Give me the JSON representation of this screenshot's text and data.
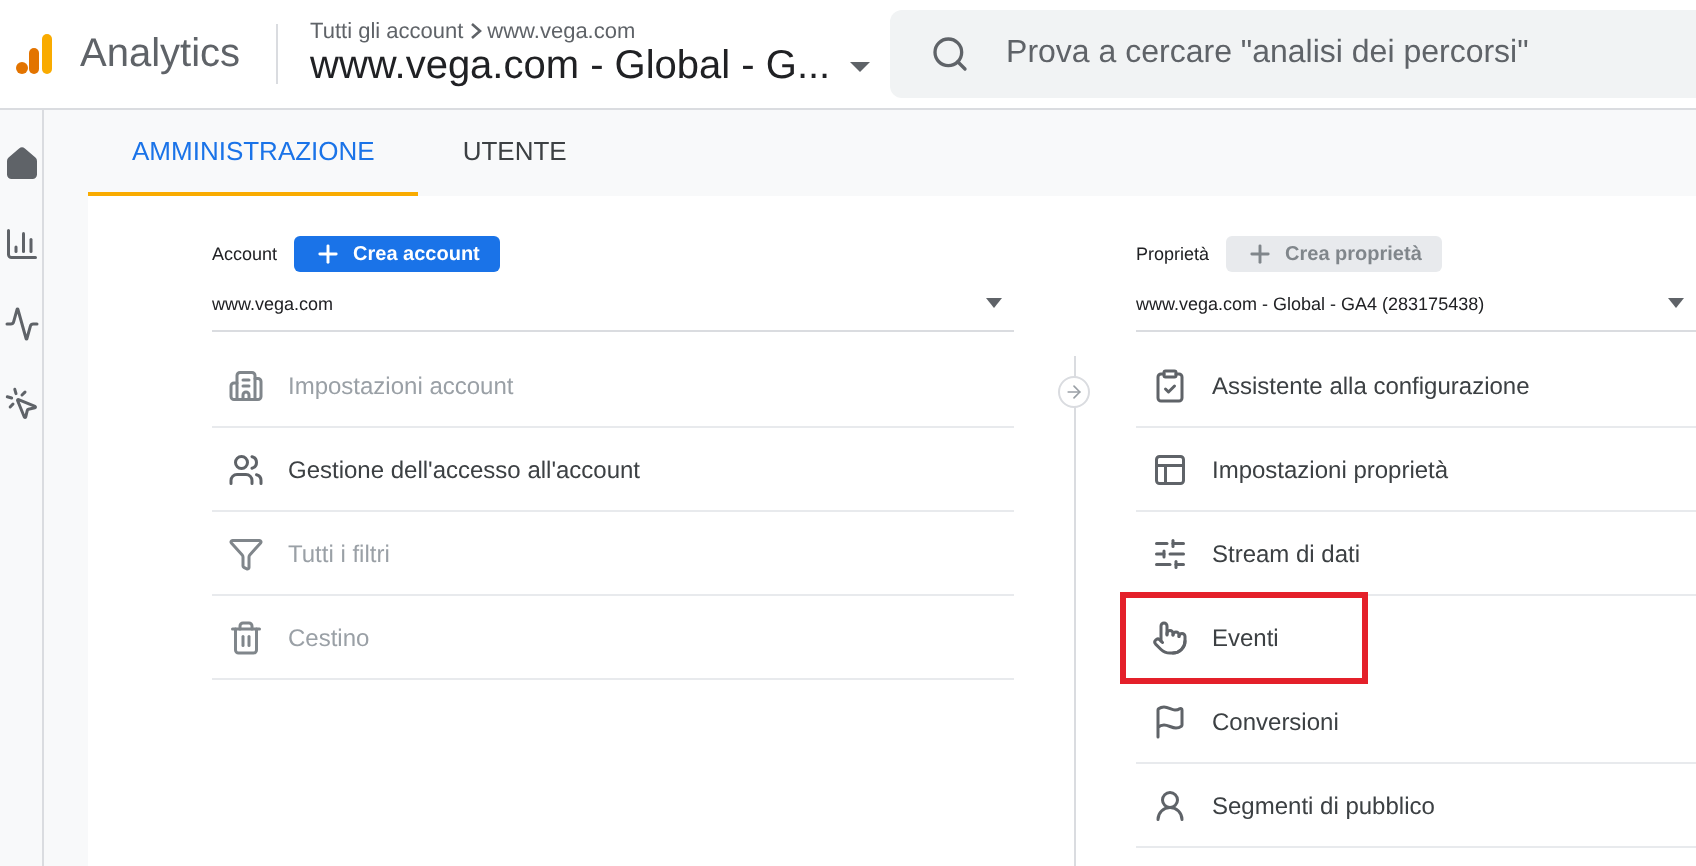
{
  "header": {
    "app_name": "Analytics",
    "breadcrumb": [
      "Tutti gli account",
      "www.vega.com"
    ],
    "property_title": "www.vega.com - Global - G...",
    "search": {
      "placeholder": "Prova a cercare \"analisi dei percorsi\""
    }
  },
  "tabs": [
    {
      "label": "AMMINISTRAZIONE",
      "selected": true
    },
    {
      "label": "UTENTE",
      "selected": false
    }
  ],
  "account": {
    "label": "Account",
    "button": {
      "label": "Crea account",
      "disabled": false
    },
    "selector": "www.vega.com",
    "items": [
      {
        "label": "Impostazioni account",
        "disabled": true,
        "highlighted": false
      },
      {
        "label": "Gestione dell'accesso all'account",
        "disabled": false,
        "highlighted": false
      },
      {
        "label": "Tutti i filtri",
        "disabled": true,
        "highlighted": false
      },
      {
        "label": "Cestino",
        "disabled": true,
        "highlighted": false
      }
    ]
  },
  "property": {
    "label": "Proprietà",
    "button": {
      "label": "Crea proprietà",
      "disabled": true
    },
    "selector": "www.vega.com - Global - GA4 (283175438)",
    "items": [
      {
        "label": "Assistente alla configurazione",
        "disabled": false,
        "highlighted": false
      },
      {
        "label": "Impostazioni proprietà",
        "disabled": false,
        "highlighted": false
      },
      {
        "label": "Stream di dati",
        "disabled": false,
        "highlighted": false
      },
      {
        "label": "Eventi",
        "disabled": false,
        "highlighted": true
      },
      {
        "label": "Conversioni",
        "disabled": false,
        "highlighted": false
      },
      {
        "label": "Segmenti di pubblico",
        "disabled": false,
        "highlighted": false
      }
    ]
  }
}
